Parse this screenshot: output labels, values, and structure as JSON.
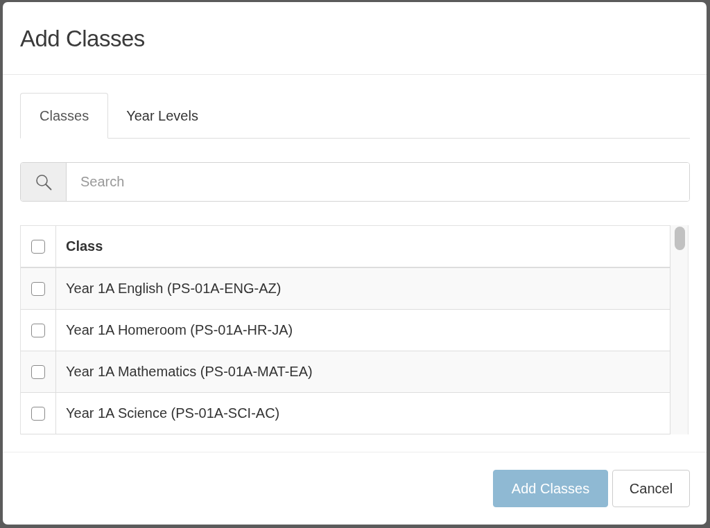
{
  "dialog": {
    "title": "Add Classes"
  },
  "tabs": [
    {
      "label": "Classes",
      "selected": true
    },
    {
      "label": "Year Levels",
      "selected": false
    }
  ],
  "search": {
    "placeholder": "Search"
  },
  "table": {
    "select_all_checked": false,
    "columns": [
      "Class"
    ],
    "rows": [
      {
        "class": "Year 1A English (PS-01A-ENG-AZ)",
        "checked": false
      },
      {
        "class": "Year 1A Homeroom (PS-01A-HR-JA)",
        "checked": false
      },
      {
        "class": "Year 1A Mathematics (PS-01A-MAT-EA)",
        "checked": false
      },
      {
        "class": "Year 1A Science (PS-01A-SCI-AC)",
        "checked": false
      }
    ]
  },
  "buttons": [
    {
      "label": "Add Classes",
      "kind": "primary",
      "disabled": true
    },
    {
      "label": "Cancel",
      "kind": "default",
      "disabled": false
    }
  ]
}
